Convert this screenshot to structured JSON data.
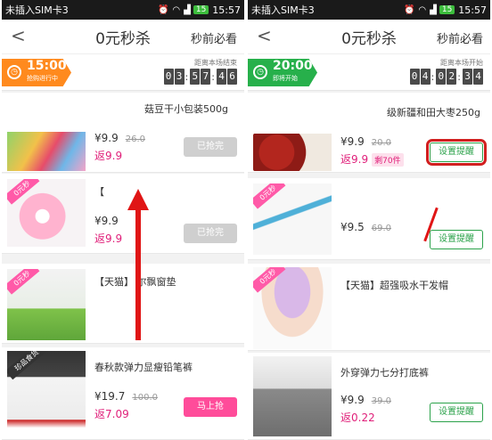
{
  "left": {
    "status": {
      "carrier": "未插入SIM卡3",
      "battery": "15",
      "time": "15:57"
    },
    "header": {
      "title": "0元秒杀",
      "back": "<",
      "right_link": "秒前必看"
    },
    "session": {
      "time": "15:00",
      "sub": "抢购进行中",
      "countdown_label": "距离本场结束",
      "countdown": [
        "0",
        "3",
        "5",
        "7",
        "4",
        "6"
      ]
    },
    "items": [
      {
        "name": "菇豆干小包装500g",
        "price": "¥9.9",
        "old": "26.0",
        "rebate_label": "返",
        "rebate": "9.9",
        "button": "已抢完"
      },
      {
        "name": "【",
        "price": "¥9.9",
        "old": "",
        "rebate_label": "返",
        "rebate": "9.9",
        "button": "已抢完",
        "badge": "0元秒"
      },
      {
        "name": "【天猫】 尔飘窗垫",
        "badge": "0元秒"
      },
      {
        "name": "春秋款弹力显瘦铅笔裤",
        "price": "¥19.7",
        "old": "100.0",
        "rebate_label": "返",
        "rebate": "7.09",
        "button": "马上抢",
        "badge": "珍品食货"
      }
    ]
  },
  "right": {
    "status": {
      "carrier": "未插入SIM卡3",
      "battery": "15",
      "time": "15:57"
    },
    "header": {
      "title": "0元秒杀",
      "back": "<",
      "right_link": "秒前必看"
    },
    "session": {
      "time": "20:00",
      "sub": "即将开始",
      "countdown_label": "距离本场开始",
      "countdown": [
        "0",
        "4",
        "0",
        "2",
        "3",
        "4"
      ]
    },
    "items": [
      {
        "name": "级新疆和田大枣250g",
        "price": "¥9.9",
        "old": "20.0",
        "rebate_label": "返",
        "rebate": "9.9",
        "remain": "剩70件",
        "button": "设置提醒"
      },
      {
        "name": "",
        "price": "¥9.5",
        "old": "69.0",
        "button": "设置提醒",
        "badge": "0元秒"
      },
      {
        "name": "【天猫】超强吸水干发帽",
        "badge": "0元秒"
      },
      {
        "name": "外穿弹力七分打底裤",
        "price": "¥9.9",
        "old": "39.0",
        "rebate_label": "返",
        "rebate": "0.22",
        "button": "设置提醒"
      }
    ]
  },
  "colors": {
    "accent_pink": "#e0207a",
    "orange": "#ff8a1e",
    "green": "#27b04b",
    "annotation_red": "#e01515"
  }
}
